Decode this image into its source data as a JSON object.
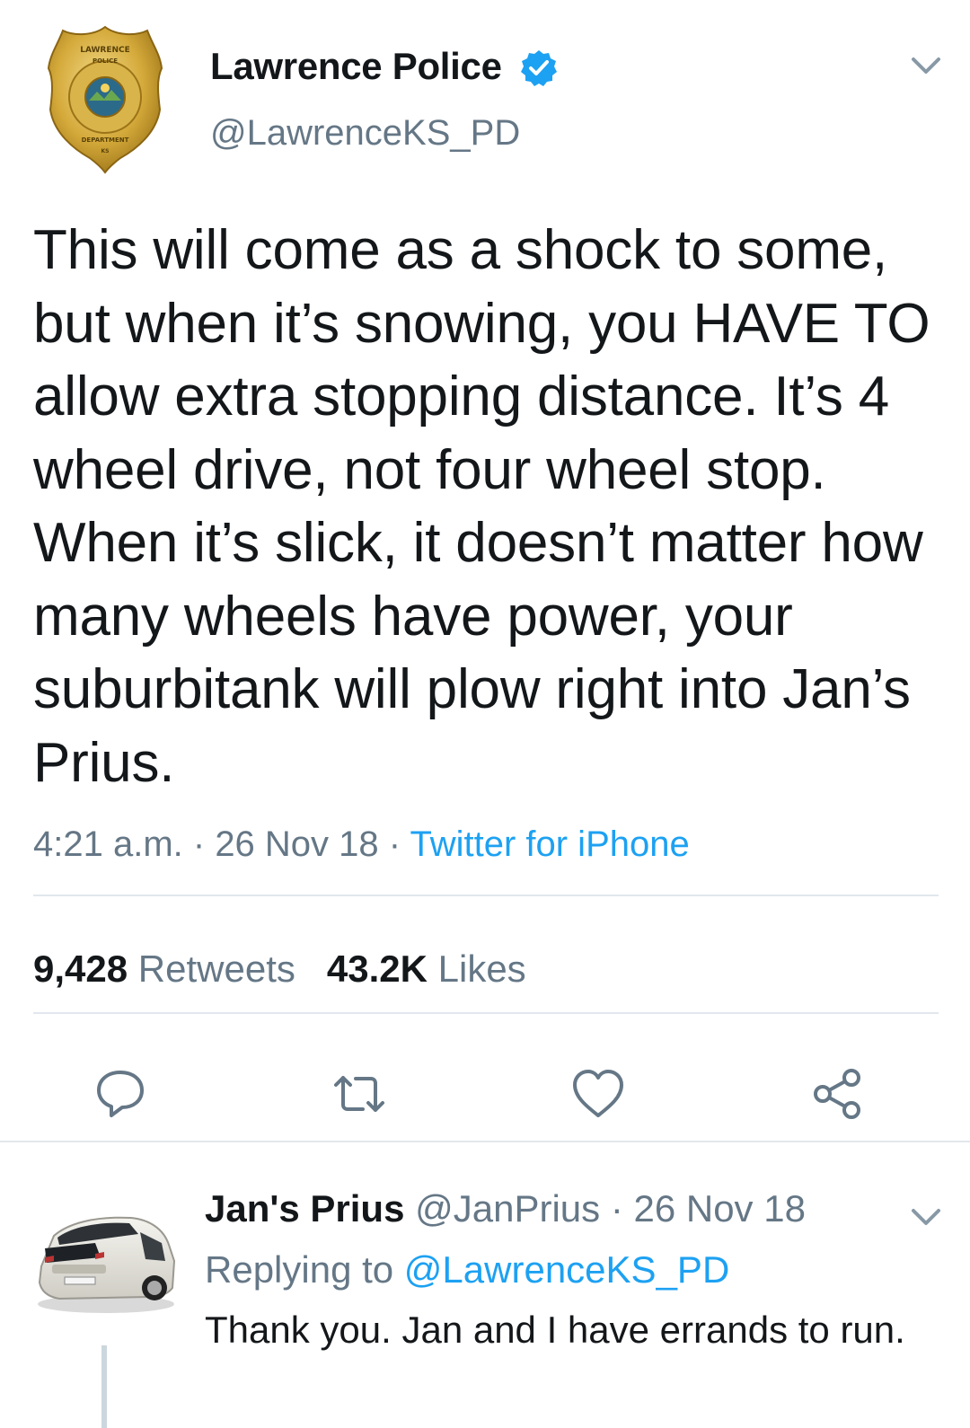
{
  "tweet": {
    "author_name": "Lawrence Police",
    "author_handle": "@LawrenceKS_PD",
    "text": "This will come as a shock to some, but when it’s snowing, you HAVE TO allow extra stopping distance. It’s 4 wheel drive, not four wheel stop. When it’s slick, it doesn’t matter how many wheels have power, your suburbitank will plow right into Jan’s Prius.",
    "time": "4:21 a.m.",
    "date": "26 Nov 18",
    "source": "Twitter for iPhone",
    "separator": " · ",
    "retweets_count": "9,428",
    "retweets_label": "Retweets",
    "likes_count": "43.2K",
    "likes_label": "Likes",
    "avatar_icon": "police-badge-icon",
    "badge_text": [
      "LAWRENCE",
      "POLICE",
      "DEPARTMENT",
      "KS"
    ]
  },
  "actions": [
    {
      "name": "reply",
      "icon": "reply-icon"
    },
    {
      "name": "retweet",
      "icon": "retweet-icon"
    },
    {
      "name": "like",
      "icon": "heart-icon"
    },
    {
      "name": "share",
      "icon": "share-icon"
    }
  ],
  "reply": {
    "author_name": "Jan's Prius",
    "author_handle": "@JanPrius",
    "date": "26 Nov 18",
    "replying_to_label": "Replying to",
    "replying_to_handle": "@LawrenceKS_PD",
    "text": "Thank you. Jan and I have errands to run.",
    "avatar_icon": "prius-car-icon"
  },
  "colors": {
    "text": "#14171a",
    "secondary": "#657786",
    "accent": "#1da1f2",
    "divider": "#e1e8ed",
    "badge_gold": "#c9a227"
  }
}
